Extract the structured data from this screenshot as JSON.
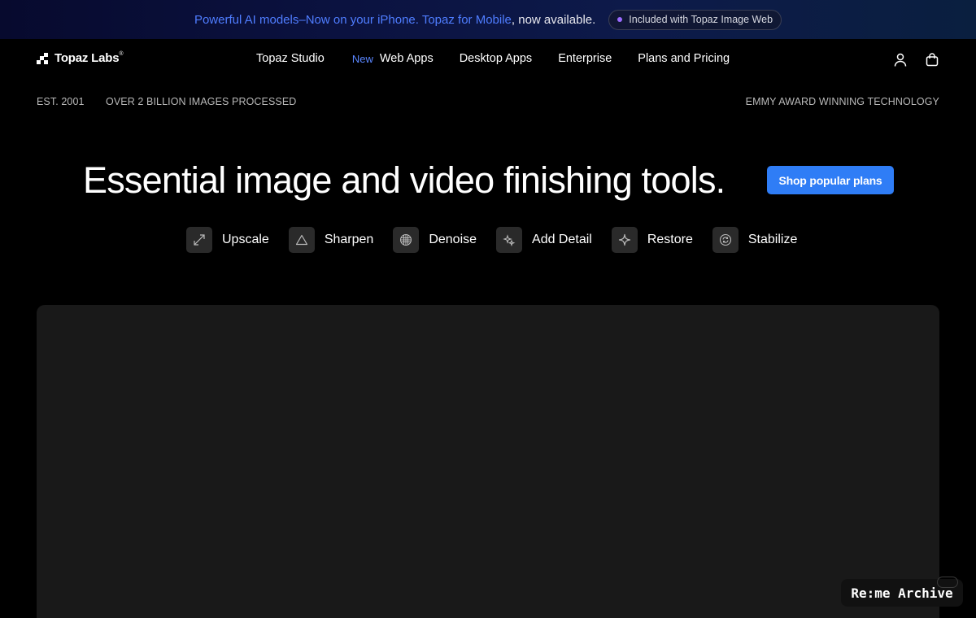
{
  "announcement": {
    "text_highlight": "Powerful AI models–Now on your iPhone. Topaz for Mobile",
    "text_rest": ", now available.",
    "pill_label": "Included with Topaz Image Web",
    "highlight_color": "#4f7dff"
  },
  "nav": {
    "logo_text": "Topaz Labs",
    "logo_mark": "®",
    "links": [
      {
        "label": "Topaz Studio"
      },
      {
        "badge": "New",
        "label": "Web Apps"
      },
      {
        "label": "Desktop Apps"
      },
      {
        "label": "Enterprise"
      },
      {
        "label": "Plans and Pricing"
      }
    ],
    "icons": [
      "user-icon",
      "shopping-bag-icon"
    ]
  },
  "stats": {
    "established": "EST. 2001",
    "images": "OVER 2 BILLION IMAGES PROCESSED",
    "award": "EMMY AWARD WINNING TECHNOLOGY"
  },
  "hero": {
    "title": "Essential image and video finishing tools.",
    "cta_label": "Shop popular plans",
    "cta_color": "#2f7df6"
  },
  "tools": [
    {
      "label": "Upscale",
      "icon": "expand-arrows-icon"
    },
    {
      "label": "Sharpen",
      "icon": "triangle-icon"
    },
    {
      "label": "Denoise",
      "icon": "grid-circle-icon"
    },
    {
      "label": "Add Detail",
      "icon": "sparkle-dots-icon"
    },
    {
      "label": "Restore",
      "icon": "four-point-star-icon"
    },
    {
      "label": "Stabilize",
      "icon": "stabilize-circle-icon"
    }
  ],
  "watermark": {
    "text": "Re:me Archive"
  }
}
